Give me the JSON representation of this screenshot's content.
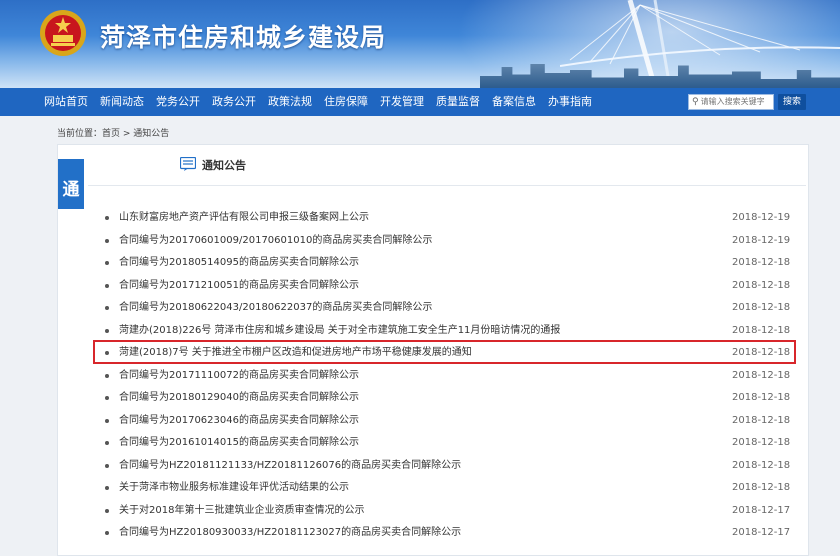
{
  "header": {
    "site_title": "菏泽市住房和城乡建设局"
  },
  "nav": {
    "items": [
      "网站首页",
      "新闻动态",
      "党务公开",
      "政务公开",
      "政策法规",
      "住房保障",
      "开发管理",
      "质量监督",
      "备案信息",
      "办事指南"
    ],
    "search_placeholder": "请输入搜索关键字",
    "search_button": "搜索"
  },
  "breadcrumb": {
    "text": "当前位置：首页 > 通知公告"
  },
  "panel": {
    "side_tab": "通",
    "title": "通知公告"
  },
  "notices": [
    {
      "title": "山东财富房地产资产评估有限公司申报三级备案网上公示",
      "date": "2018-12-19"
    },
    {
      "title": "合同编号为20170601009/20170601010的商品房买卖合同解除公示",
      "date": "2018-12-19"
    },
    {
      "title": "合同编号为20180514095的商品房买卖合同解除公示",
      "date": "2018-12-18"
    },
    {
      "title": "合同编号为20171210051的商品房买卖合同解除公示",
      "date": "2018-12-18"
    },
    {
      "title": "合同编号为20180622043/20180622037的商品房买卖合同解除公示",
      "date": "2018-12-18"
    },
    {
      "title": "菏建办(2018)226号 菏泽市住房和城乡建设局 关于对全市建筑施工安全生产11月份暗访情况的通报",
      "date": "2018-12-18"
    },
    {
      "title": "菏建(2018)7号 关于推进全市棚户区改造和促进房地产市场平稳健康发展的通知",
      "date": "2018-12-18"
    },
    {
      "title": "合同编号为20171110072的商品房买卖合同解除公示",
      "date": "2018-12-18"
    },
    {
      "title": "合同编号为20180129040的商品房买卖合同解除公示",
      "date": "2018-12-18"
    },
    {
      "title": "合同编号为20170623046的商品房买卖合同解除公示",
      "date": "2018-12-18"
    },
    {
      "title": "合同编号为20161014015的商品房买卖合同解除公示",
      "date": "2018-12-18"
    },
    {
      "title": "合同编号为HZ20181121133/HZ20181126076的商品房买卖合同解除公示",
      "date": "2018-12-18"
    },
    {
      "title": "关于菏泽市物业服务标准建设年评优活动结果的公示",
      "date": "2018-12-18"
    },
    {
      "title": "关于对2018年第十三批建筑业企业资质审查情况的公示",
      "date": "2018-12-17"
    },
    {
      "title": "合同编号为HZ20180930033/HZ20181123027的商品房买卖合同解除公示",
      "date": "2018-12-17"
    }
  ],
  "colors": {
    "nav_bg": "#1f66c1",
    "accent": "#2270c8",
    "highlight_border": "#d8262b"
  }
}
